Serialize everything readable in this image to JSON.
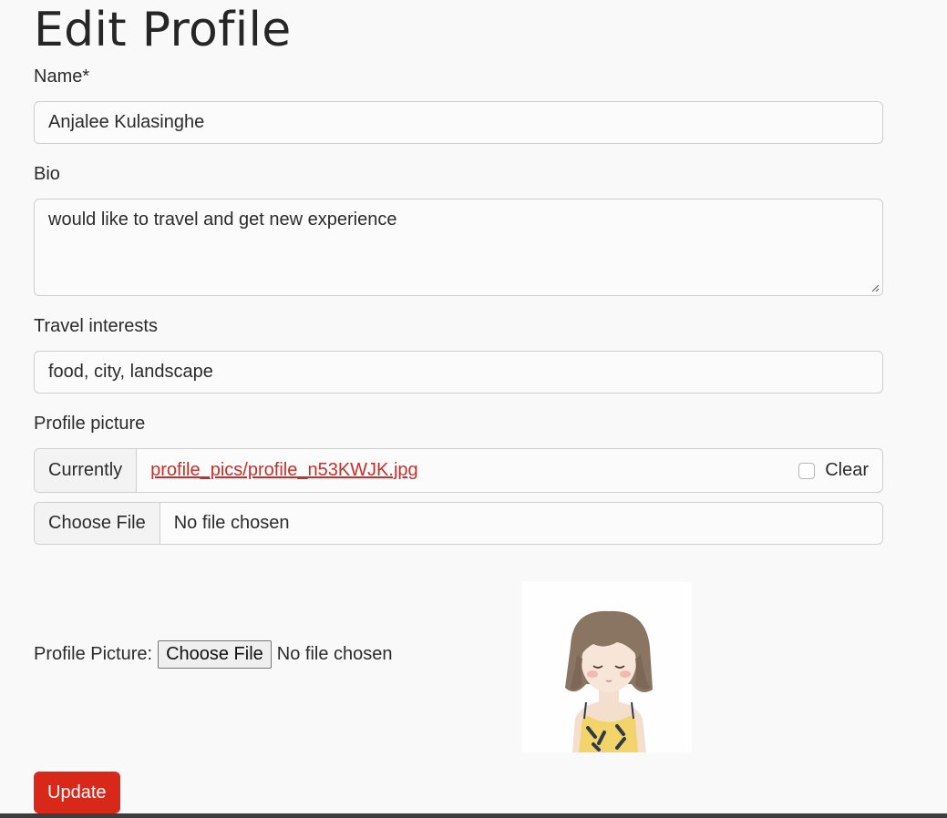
{
  "page": {
    "title": "Edit Profile"
  },
  "form": {
    "name_label": "Name*",
    "name_value": "Anjalee Kulasinghe",
    "bio_label": "Bio",
    "bio_value": "would like to travel and get new experience",
    "interests_label": "Travel interests",
    "interests_value": "food, city, landscape",
    "picture_label": "Profile picture",
    "currently_label": "Currently",
    "current_file": "profile_pics/profile_n53KWJK.jpg",
    "clear_label": "Clear",
    "choose_file_label": "Choose File",
    "no_file_label": "No file chosen",
    "pp_label": "Profile Picture:",
    "pp_choose_label": "Choose File",
    "pp_no_file_label": "No file chosen",
    "update_label": "Update"
  },
  "colors": {
    "accent": "#d8281a",
    "link": "#c6302b"
  },
  "icons": {
    "resize": "resize-handle-icon",
    "avatar": "avatar-illustration"
  }
}
